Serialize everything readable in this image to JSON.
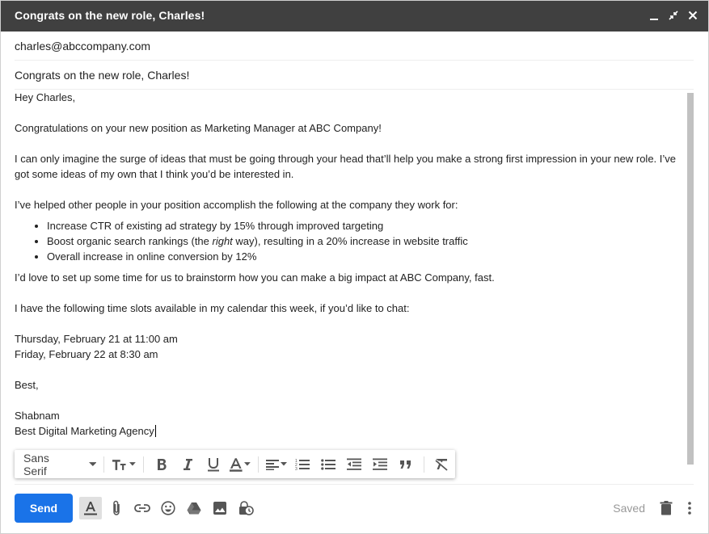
{
  "window": {
    "title": "Congrats on the new role, Charles!"
  },
  "compose": {
    "to": "charles@abccompany.com",
    "subject": "Congrats on the new role, Charles!",
    "body": {
      "greeting": "Hey Charles,",
      "p1": "Congratulations on your new position as Marketing Manager at ABC Company!",
      "p2a": "I can only imagine the surge of ideas that must be going through your head that’ll help you make a strong first impression in your new role. I’ve",
      "p2b": "got some ideas of my own that I think you’d be interested in.",
      "p3": "I’ve helped other people in your position accomplish the following at the company they work for:",
      "bullet1": "Increase CTR of existing ad strategy by 15% through improved targeting",
      "bullet2_pre": "Boost organic search rankings (the ",
      "bullet2_em": "right",
      "bullet2_post": " way), resulting in a 20% increase in website traffic",
      "bullet3": "Overall increase in online conversion by 12%",
      "p4": "I’d love to set up some time for us to brainstorm how you can make a big impact at ABC Company, fast.",
      "p5": "I have the following time slots available in my calendar this week, if you’d like to chat:",
      "slot1": "Thursday, February 21 at 11:00 am",
      "slot2": "Friday, February 22 at 8:30 am",
      "signoff": "Best,",
      "name": "Shabnam",
      "company": "Best Digital Marketing Agency"
    }
  },
  "formatting": {
    "font": "Sans Serif"
  },
  "footer": {
    "send_label": "Send",
    "saved_label": "Saved"
  },
  "colors": {
    "titlebar": "#404040",
    "send": "#1a73e8"
  }
}
